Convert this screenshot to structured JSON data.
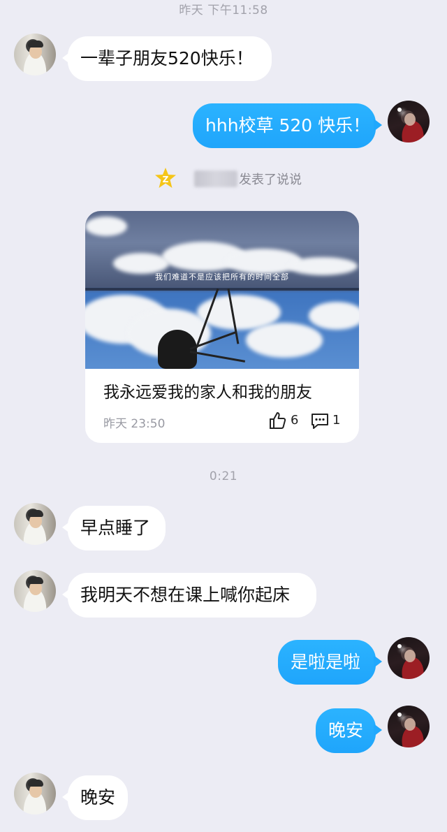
{
  "timestamps": {
    "top": "昨天 下午11:58",
    "middle": "0:21"
  },
  "messages": [
    {
      "side": "left",
      "text": "一辈子朋友520快乐！"
    },
    {
      "side": "right",
      "text": "hhh校草 520 快乐！"
    },
    {
      "side": "left",
      "text": "早点睡了"
    },
    {
      "side": "left",
      "text": "我明天不想在课上喊你起床"
    },
    {
      "side": "right",
      "text": "是啦是啦"
    },
    {
      "side": "right",
      "text": "晚安"
    },
    {
      "side": "left",
      "text": "晚安"
    }
  ],
  "shared_post": {
    "action_text": "发表了说说",
    "image_caption": "我们难道不是应该把所有的时间全部",
    "title": "我永远爱我的家人和我的朋友",
    "time": "昨天 23:50",
    "likes": "6",
    "comments": "1"
  },
  "colors": {
    "background": "#ececf4",
    "outgoing_bubble": "#22aaff",
    "incoming_bubble": "#ffffff",
    "qzone_star": "#f5c518"
  },
  "icons": [
    "qzone-star-icon",
    "thumbs-up-icon",
    "comment-icon"
  ]
}
